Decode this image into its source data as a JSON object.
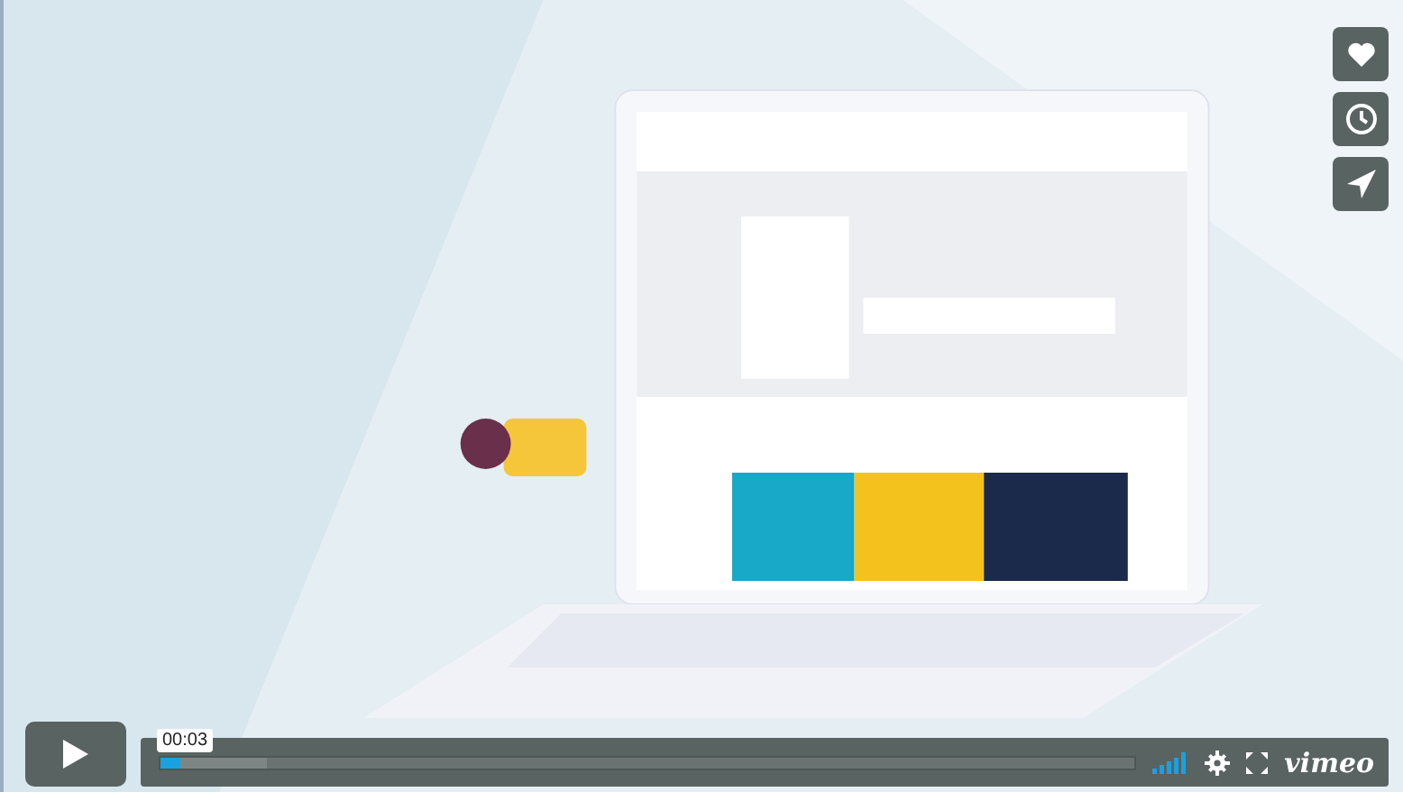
{
  "side_buttons": [
    {
      "kind": "like"
    },
    {
      "kind": "watch_later"
    },
    {
      "kind": "share"
    }
  ],
  "controls": {
    "time": "00:03",
    "progress": {
      "level": 0.02
    },
    "loaded": {
      "level": 0.11
    },
    "logo": "vimeo"
  }
}
